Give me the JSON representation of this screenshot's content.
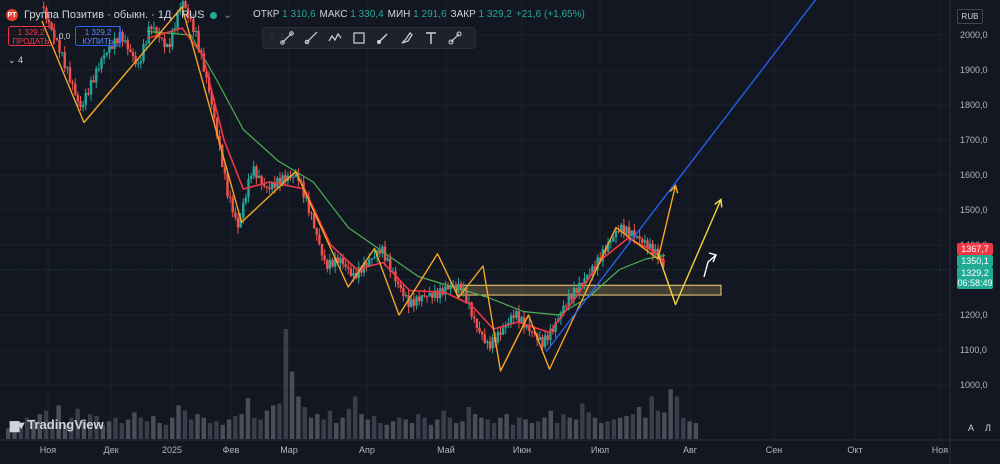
{
  "header": {
    "symbol_icon": "PT",
    "title": "Группа Позитив · обыкн. · 1Д · RUS",
    "ohlc": [
      {
        "k": "ОТКР",
        "v": "1 310,6"
      },
      {
        "k": "МАКС",
        "v": "1 330,4"
      },
      {
        "k": "МИН",
        "v": "1 291,6"
      },
      {
        "k": "ЗАКР",
        "v": "1 329,2"
      },
      {
        "k": "",
        "v": "+21,6 (+1,65%)"
      }
    ]
  },
  "trade": {
    "sell_price": "1 329,2",
    "sell_label": "ПРОДАТЬ",
    "spread": "0,0",
    "buy_price": "1 329,2",
    "buy_label": "КУПИТЬ"
  },
  "layers_label": "4",
  "currency": "RUB",
  "toolbar_icons": [
    "trend-line-icon",
    "ray-icon",
    "polyline-icon",
    "rectangle-icon",
    "brush-icon",
    "highlighter-icon",
    "text-icon",
    "measure-icon"
  ],
  "price_labels": [
    {
      "text": "1367,7",
      "color": "#f23645"
    },
    {
      "text": "1350,1",
      "color": "#22ab94"
    },
    {
      "text": "1329,2",
      "color": "#22ab94"
    },
    {
      "text": "06:58:49",
      "color": "#22ab94"
    }
  ],
  "logo": "TradingView",
  "bottom_buttons": [
    "A",
    "Л"
  ],
  "colors": {
    "up": "#26a69a",
    "down": "#ef5350",
    "ema_fast": "#f23645",
    "ema_slow": "#4caf50",
    "zigzag": "#f5a623",
    "trend": "#2962ff",
    "projection_up": "#f5d33b",
    "zone": "#f5d37b"
  },
  "chart_data": {
    "type": "candlestick",
    "title": "",
    "xlabel": "",
    "ylabel": "",
    "ylim": [
      850,
      2100
    ],
    "y_ticks": [
      1000,
      1100,
      1200,
      1300,
      1400,
      1500,
      1600,
      1700,
      1800,
      1900,
      2000
    ],
    "y_tick_labels": [
      "1000,0",
      "1100,0",
      "1200,0",
      "1300,0",
      "1400,0",
      "1500,0",
      "1600,0",
      "1700,0",
      "1800,0",
      "1900,0",
      "2000,0"
    ],
    "x_ticks": [
      "Ноя",
      "Дек",
      "2025",
      "Фев",
      "Мар",
      "Апр",
      "Май",
      "Июн",
      "Июл",
      "Авг",
      "Сен",
      "Окт",
      "Ноя"
    ],
    "close_path": [
      {
        "d": 0,
        "v": 2080
      },
      {
        "d": 10,
        "v": 1960
      },
      {
        "d": 22,
        "v": 1790
      },
      {
        "d": 35,
        "v": 1940
      },
      {
        "d": 45,
        "v": 2000
      },
      {
        "d": 55,
        "v": 1910
      },
      {
        "d": 62,
        "v": 2030
      },
      {
        "d": 72,
        "v": 1960
      },
      {
        "d": 80,
        "v": 2100
      },
      {
        "d": 88,
        "v": 2000
      },
      {
        "d": 96,
        "v": 1830
      },
      {
        "d": 106,
        "v": 1550
      },
      {
        "d": 112,
        "v": 1450
      },
      {
        "d": 120,
        "v": 1620
      },
      {
        "d": 128,
        "v": 1560
      },
      {
        "d": 138,
        "v": 1590
      },
      {
        "d": 146,
        "v": 1600
      },
      {
        "d": 154,
        "v": 1480
      },
      {
        "d": 162,
        "v": 1340
      },
      {
        "d": 170,
        "v": 1360
      },
      {
        "d": 178,
        "v": 1310
      },
      {
        "d": 186,
        "v": 1350
      },
      {
        "d": 194,
        "v": 1390
      },
      {
        "d": 202,
        "v": 1300
      },
      {
        "d": 210,
        "v": 1230
      },
      {
        "d": 218,
        "v": 1255
      },
      {
        "d": 226,
        "v": 1260
      },
      {
        "d": 234,
        "v": 1285
      },
      {
        "d": 240,
        "v": 1280
      },
      {
        "d": 248,
        "v": 1170
      },
      {
        "d": 255,
        "v": 1110
      },
      {
        "d": 262,
        "v": 1150
      },
      {
        "d": 270,
        "v": 1205
      },
      {
        "d": 278,
        "v": 1160
      },
      {
        "d": 286,
        "v": 1120
      },
      {
        "d": 292,
        "v": 1160
      },
      {
        "d": 300,
        "v": 1240
      },
      {
        "d": 308,
        "v": 1290
      },
      {
        "d": 316,
        "v": 1340
      },
      {
        "d": 322,
        "v": 1390
      },
      {
        "d": 330,
        "v": 1450
      },
      {
        "d": 338,
        "v": 1430
      },
      {
        "d": 346,
        "v": 1400
      },
      {
        "d": 352,
        "v": 1370
      },
      {
        "d": 356,
        "v": 1330
      }
    ],
    "ema_fast": [
      {
        "d": 60,
        "v": 1990
      },
      {
        "d": 80,
        "v": 2020
      },
      {
        "d": 92,
        "v": 1940
      },
      {
        "d": 104,
        "v": 1700
      },
      {
        "d": 115,
        "v": 1560
      },
      {
        "d": 130,
        "v": 1580
      },
      {
        "d": 150,
        "v": 1560
      },
      {
        "d": 165,
        "v": 1400
      },
      {
        "d": 180,
        "v": 1330
      },
      {
        "d": 195,
        "v": 1350
      },
      {
        "d": 210,
        "v": 1270
      },
      {
        "d": 230,
        "v": 1265
      },
      {
        "d": 245,
        "v": 1230
      },
      {
        "d": 258,
        "v": 1160
      },
      {
        "d": 272,
        "v": 1180
      },
      {
        "d": 290,
        "v": 1150
      },
      {
        "d": 305,
        "v": 1250
      },
      {
        "d": 320,
        "v": 1360
      },
      {
        "d": 335,
        "v": 1420
      },
      {
        "d": 350,
        "v": 1380
      },
      {
        "d": 356,
        "v": 1350
      }
    ],
    "ema_slow": [
      {
        "d": 60,
        "v": 2010
      },
      {
        "d": 85,
        "v": 2000
      },
      {
        "d": 100,
        "v": 1870
      },
      {
        "d": 115,
        "v": 1730
      },
      {
        "d": 135,
        "v": 1640
      },
      {
        "d": 155,
        "v": 1580
      },
      {
        "d": 175,
        "v": 1450
      },
      {
        "d": 195,
        "v": 1380
      },
      {
        "d": 215,
        "v": 1310
      },
      {
        "d": 235,
        "v": 1280
      },
      {
        "d": 255,
        "v": 1250
      },
      {
        "d": 275,
        "v": 1210
      },
      {
        "d": 295,
        "v": 1200
      },
      {
        "d": 312,
        "v": 1250
      },
      {
        "d": 330,
        "v": 1330
      },
      {
        "d": 345,
        "v": 1360
      },
      {
        "d": 356,
        "v": 1370
      }
    ],
    "zigzag": [
      {
        "d": 0,
        "v": 2040
      },
      {
        "d": 24,
        "v": 1750
      },
      {
        "d": 80,
        "v": 2080
      },
      {
        "d": 114,
        "v": 1465
      },
      {
        "d": 145,
        "v": 1610
      },
      {
        "d": 175,
        "v": 1280
      },
      {
        "d": 190,
        "v": 1390
      },
      {
        "d": 204,
        "v": 1200
      },
      {
        "d": 226,
        "v": 1375
      },
      {
        "d": 238,
        "v": 1250
      },
      {
        "d": 252,
        "v": 1340
      },
      {
        "d": 262,
        "v": 1040
      },
      {
        "d": 278,
        "v": 1200
      },
      {
        "d": 290,
        "v": 1045
      },
      {
        "d": 328,
        "v": 1450
      },
      {
        "d": 352,
        "v": 1360
      },
      {
        "d": 362,
        "v": 1570
      }
    ],
    "projection": [
      {
        "d": 352,
        "v": 1375
      },
      {
        "d": 362,
        "v": 1230
      },
      {
        "d": 388,
        "v": 1530
      }
    ],
    "trend_line": [
      {
        "d": 288,
        "v": 1095
      },
      {
        "d": 445,
        "v": 2120
      }
    ],
    "zone": {
      "d_from": 237,
      "d_to": 388,
      "v_low": 1257,
      "v_high": 1285
    },
    "volume_max": 310,
    "volume": [
      30,
      45,
      40,
      60,
      55,
      70,
      80,
      50,
      95,
      40,
      60,
      85,
      55,
      70,
      65,
      40,
      50,
      60,
      45,
      55,
      75,
      60,
      50,
      65,
      45,
      40,
      60,
      95,
      80,
      55,
      70,
      60,
      45,
      50,
      40,
      55,
      65,
      70,
      115,
      60,
      55,
      80,
      95,
      100,
      310,
      190,
      120,
      90,
      60,
      70,
      55,
      80,
      45,
      60,
      85,
      120,
      70,
      55,
      65,
      45,
      40,
      50,
      60,
      55,
      45,
      70,
      60,
      40,
      55,
      80,
      60,
      45,
      50,
      90,
      70,
      60,
      55,
      45,
      60,
      70,
      40,
      60,
      55,
      45,
      50,
      60,
      80,
      45,
      70,
      60,
      55,
      100,
      75,
      60,
      45,
      50,
      55,
      60,
      65,
      70,
      90,
      60,
      120,
      80,
      75,
      140,
      120,
      60,
      50,
      45
    ]
  }
}
